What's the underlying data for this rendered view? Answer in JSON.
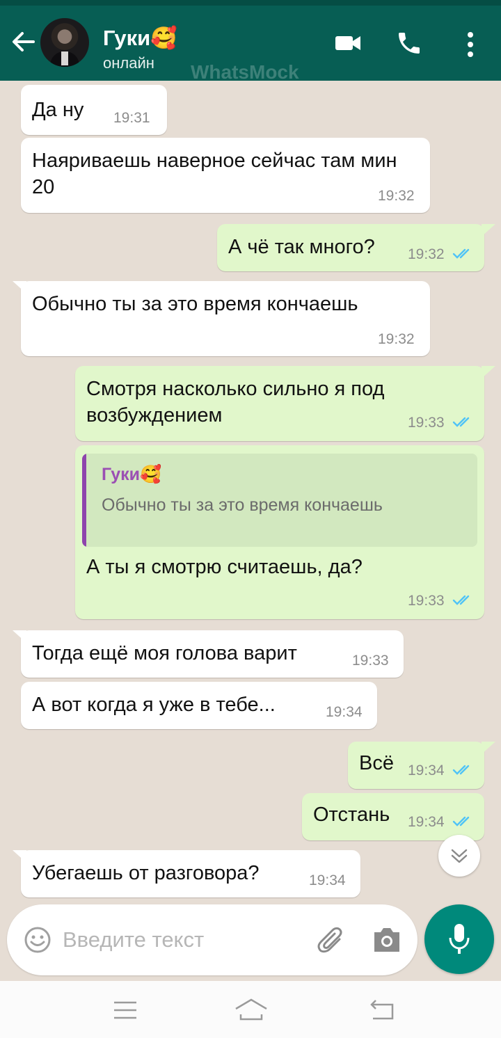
{
  "header": {
    "contact_name": "Гуки🥰",
    "status": "онлайн",
    "watermark": "WhatsMock",
    "back_icon": "arrow-left-icon",
    "video_icon": "video-camera-icon",
    "call_icon": "phone-icon",
    "menu_icon": "more-vertical-icon"
  },
  "messages": [
    {
      "dir": "in",
      "text": "Да ну",
      "time": "19:31"
    },
    {
      "dir": "in",
      "text": "Наяриваешь наверное сейчас там мин 20",
      "time": "19:32"
    },
    {
      "dir": "out",
      "text": "А чё так много?",
      "time": "19:32",
      "read": true
    },
    {
      "dir": "in",
      "text": "Обычно ты за это время кончаешь",
      "time": "19:32"
    },
    {
      "dir": "out",
      "text": "Смотря насколько сильно я под возбуждением",
      "time": "19:33",
      "read": true
    },
    {
      "dir": "out",
      "text": "А ты я смотрю считаешь, да?",
      "time": "19:33",
      "read": true,
      "reply_to": {
        "name": "Гуки🥰",
        "text": "Обычно ты за это время кончаешь"
      }
    },
    {
      "dir": "in",
      "text": "Тогда ещё моя голова варит",
      "time": "19:33"
    },
    {
      "dir": "in",
      "text": "А вот когда я уже в тебе...",
      "time": "19:34"
    },
    {
      "dir": "out",
      "text": "Всё",
      "time": "19:34",
      "read": true
    },
    {
      "dir": "out",
      "text": "Отстань",
      "time": "19:34",
      "read": true
    },
    {
      "dir": "in",
      "text": "Убегаешь от разговора?",
      "time": "19:34"
    }
  ],
  "input": {
    "placeholder": "Введите текст",
    "emoji_icon": "emoji-icon",
    "attach_icon": "paperclip-icon",
    "camera_icon": "camera-icon",
    "mic_icon": "microphone-icon",
    "scroll_icon": "chevron-double-down-icon"
  },
  "navbar": {
    "menu_icon": "menu-lines-icon",
    "home_icon": "home-icon",
    "back_icon": "back-return-icon"
  },
  "colors": {
    "header": "#075e54",
    "incoming": "#ffffff",
    "outgoing": "#e1f7cb",
    "read_ticks": "#4fc3f7",
    "mic": "#00897b",
    "background": "#e6ddd4"
  }
}
